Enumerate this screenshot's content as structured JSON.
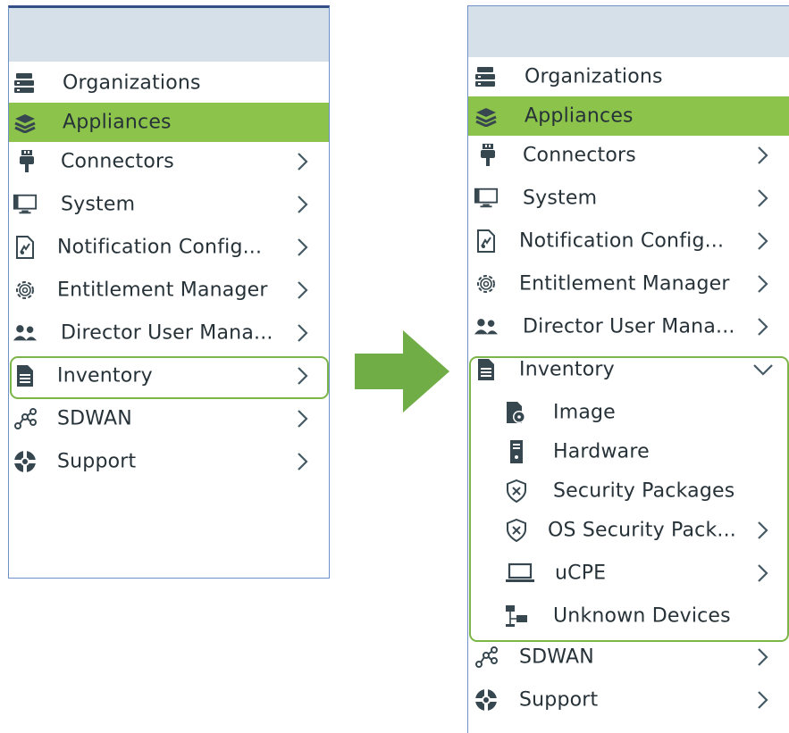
{
  "colors": {
    "header_bg": "#d6e0e9",
    "active_bg": "#8cc34a",
    "outline": "#7cb548",
    "arrow": "#70ad47",
    "icon": "#37474f",
    "panel_border": "#6f8fc9"
  },
  "before": {
    "items": [
      {
        "label": "Organizations",
        "icon": "organizations-icon"
      },
      {
        "label": "Appliances",
        "icon": "appliances-icon",
        "active": true
      },
      {
        "label": "Connectors",
        "icon": "connectors-icon"
      },
      {
        "label": "System",
        "icon": "system-icon"
      },
      {
        "label": "Notification Config...",
        "icon": "notification-icon"
      },
      {
        "label": "Entitlement Manager",
        "icon": "gear-icon"
      },
      {
        "label": "Director User Mana...",
        "icon": "users-icon"
      },
      {
        "label": "Inventory",
        "icon": "inventory-icon",
        "highlighted": true
      },
      {
        "label": "SDWAN",
        "icon": "sdwan-icon"
      },
      {
        "label": "Support",
        "icon": "lifebuoy-icon"
      }
    ]
  },
  "after": {
    "items": [
      {
        "label": "Organizations",
        "icon": "organizations-icon"
      },
      {
        "label": "Appliances",
        "icon": "appliances-icon",
        "active": true
      },
      {
        "label": "Connectors",
        "icon": "connectors-icon"
      },
      {
        "label": "System",
        "icon": "system-icon"
      },
      {
        "label": "Notification Config...",
        "icon": "notification-icon"
      },
      {
        "label": "Entitlement Manager",
        "icon": "gear-icon"
      },
      {
        "label": "Director User Mana...",
        "icon": "users-icon"
      },
      {
        "label": "Inventory",
        "icon": "inventory-icon",
        "expanded": true
      },
      {
        "label": "SDWAN",
        "icon": "sdwan-icon"
      },
      {
        "label": "Support",
        "icon": "lifebuoy-icon"
      }
    ],
    "inventory_children": [
      {
        "label": "Image",
        "icon": "image-disk-icon"
      },
      {
        "label": "Hardware",
        "icon": "hardware-icon"
      },
      {
        "label": "Security Packages",
        "icon": "shield-icon"
      },
      {
        "label": "OS Security Pack...",
        "icon": "shield-icon"
      },
      {
        "label": "uCPE",
        "icon": "laptop-icon"
      },
      {
        "label": "Unknown Devices",
        "icon": "network-devices-icon"
      }
    ]
  }
}
